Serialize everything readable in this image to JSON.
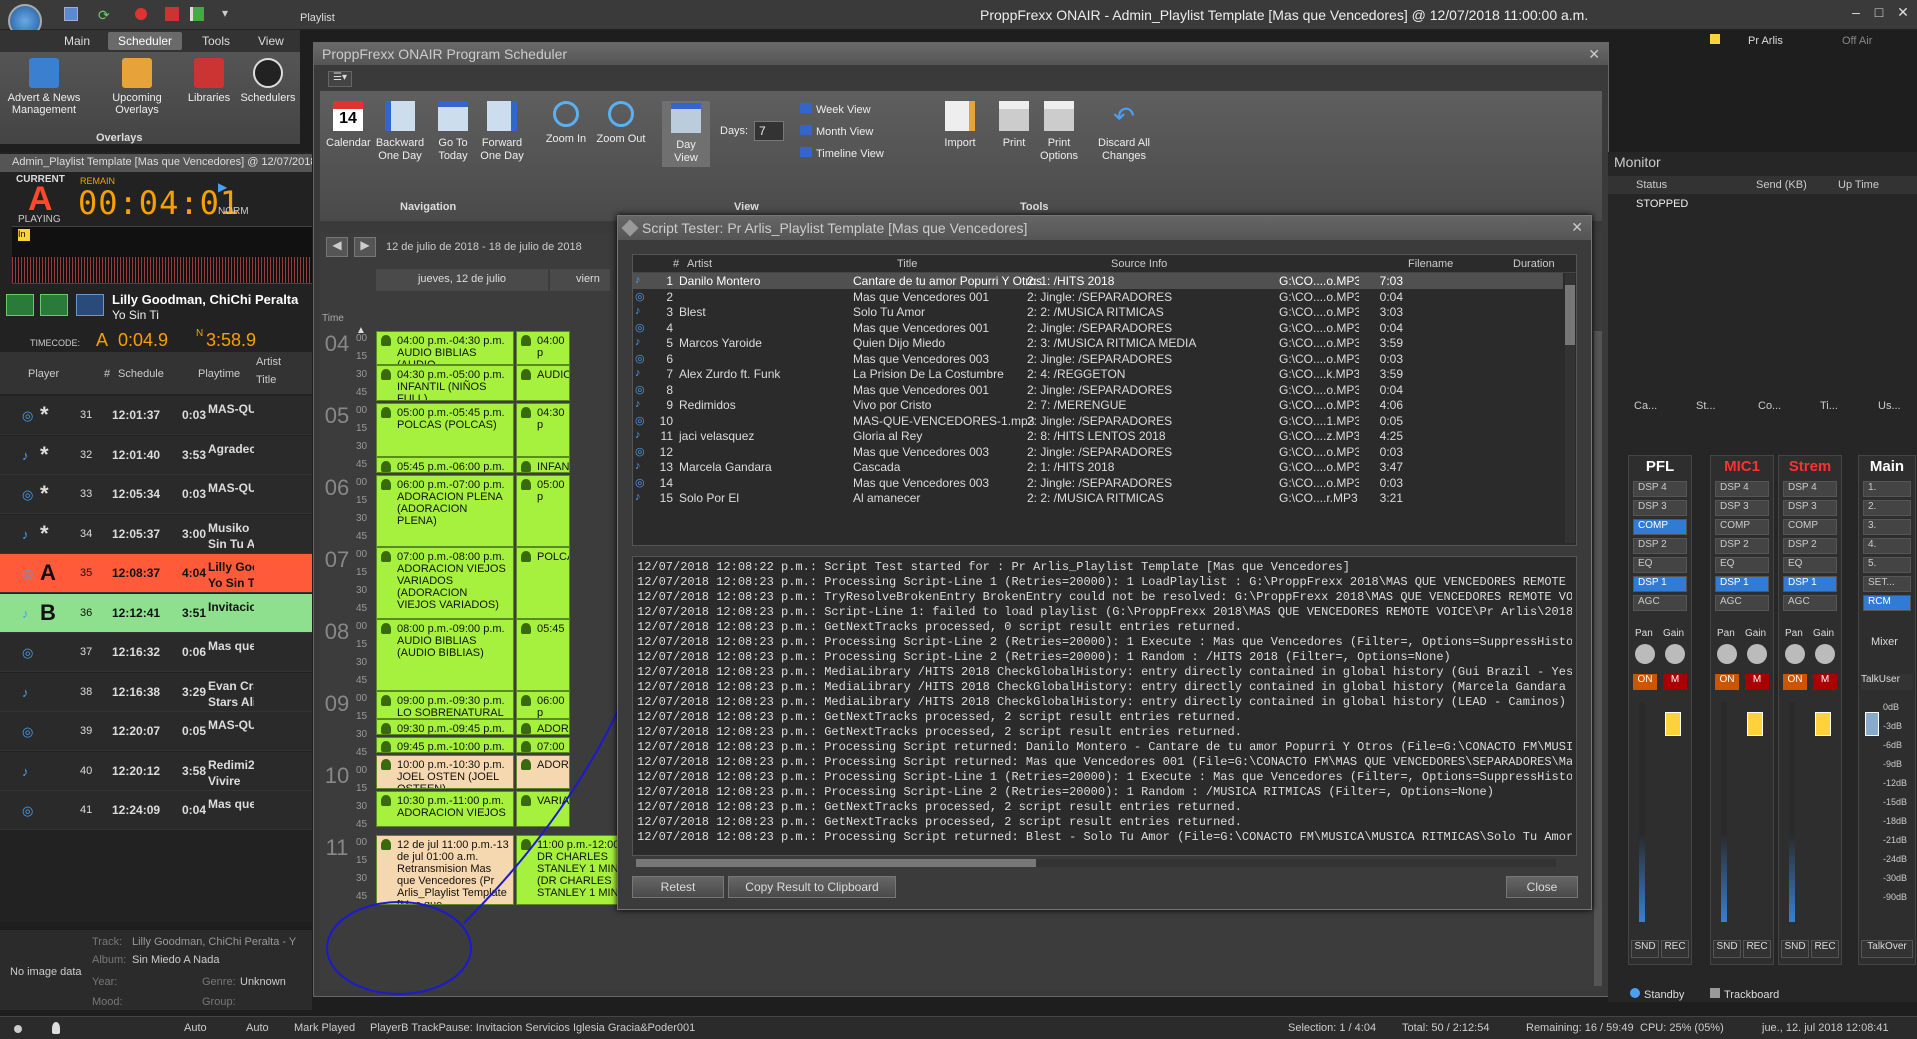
{
  "app": {
    "title": "ProppFrexx ONAIR - Admin_Playlist Template [Mas que Vencedores] @ 12/07/2018 11:00:00 a.m.",
    "playlist_tab": "Playlist",
    "user": "Pr Arlis",
    "off_air": "Off Air"
  },
  "ribbon": {
    "tabs": [
      "Main",
      "Scheduler",
      "Tools",
      "View"
    ],
    "buttons": [
      "Advert & News Management",
      "Upcoming Overlays",
      "Libraries",
      "Schedulers"
    ],
    "group": "Overlays"
  },
  "player": {
    "header": "Admin_Playlist Template [Mas que Vencedores] @ 12/07/2018",
    "current": "CURRENT",
    "deck": "A",
    "playing": "PLAYING",
    "remain_label": "REMAIN",
    "remain": "00:04:01",
    "mode": "NORM",
    "artist": "Lilly Goodman, ChiChi Peralta",
    "title": "Yo Sin Ti",
    "timecode_label": "TIMECODE:",
    "pos_a": "A",
    "pos_a_time": "0:04.9",
    "pos_n": "N",
    "pos_n_time": "3:58.9"
  },
  "playlist": {
    "columns": [
      "Player",
      "#",
      "Schedule",
      "Playtime",
      "Artist",
      "Title"
    ],
    "rows": [
      {
        "player": "*",
        "num": "31",
        "schedule": "12:01:37",
        "playtime": "0:03",
        "artist": "MAS-QUI",
        "title": ""
      },
      {
        "player": "*",
        "num": "32",
        "schedule": "12:01:40",
        "playtime": "3:53",
        "artist": "Agradeci",
        "title": ""
      },
      {
        "player": "*",
        "num": "33",
        "schedule": "12:05:34",
        "playtime": "0:03",
        "artist": "MAS-QUI",
        "title": ""
      },
      {
        "player": "*",
        "num": "34",
        "schedule": "12:05:37",
        "playtime": "3:00",
        "artist": "Musiko",
        "title": "Sin Tu Ar"
      },
      {
        "player": "A",
        "num": "35",
        "schedule": "12:08:37",
        "playtime": "4:04",
        "artist": "Lilly Goo",
        "title": "Yo Sin Ti"
      },
      {
        "player": "B",
        "num": "36",
        "schedule": "12:12:41",
        "playtime": "3:51",
        "artist": "Invitacio",
        "title": ""
      },
      {
        "player": "",
        "num": "37",
        "schedule": "12:16:32",
        "playtime": "0:06",
        "artist": "Mas que",
        "title": ""
      },
      {
        "player": "",
        "num": "38",
        "schedule": "12:16:38",
        "playtime": "3:29",
        "artist": "Evan Cra",
        "title": "Stars Alig"
      },
      {
        "player": "",
        "num": "39",
        "schedule": "12:20:07",
        "playtime": "0:05",
        "artist": "MAS-QUI",
        "title": ""
      },
      {
        "player": "",
        "num": "40",
        "schedule": "12:20:12",
        "playtime": "3:58",
        "artist": "Redimi2",
        "title": "Vivire"
      },
      {
        "player": "",
        "num": "41",
        "schedule": "12:24:09",
        "playtime": "0:04",
        "artist": "Mas que",
        "title": ""
      }
    ]
  },
  "info": {
    "no_image": "No image data",
    "track_label": "Track:",
    "track": "Lilly Goodman, ChiChi Peralta - Y",
    "album_label": "Album:",
    "album": "Sin Miedo A Nada",
    "year_label": "Year:",
    "genre_label": "Genre:",
    "genre": "Unknown",
    "mood_label": "Mood:",
    "group_label": "Group:"
  },
  "scheduler": {
    "title": "ProppFrexx ONAIR Program Scheduler",
    "buttons": {
      "calendar": "Calendar",
      "backward": "Backward One Day",
      "goto_today": "Go To Today",
      "forward": "Forward One Day",
      "zoom_in": "Zoom In",
      "zoom_out": "Zoom Out",
      "day_view": "Day View",
      "days_label": "Days:",
      "days_value": "7",
      "week_view": "Week View",
      "month_view": "Month View",
      "timeline_view": "Timeline View",
      "import": "Import",
      "print": "Print",
      "print_options": "Print Options",
      "discard": "Discard All Changes"
    },
    "groups": {
      "navigation": "Navigation",
      "view": "View",
      "tools": "Tools"
    },
    "calendar_day": "14",
    "date_range": "12 de julio de 2018 - 18 de julio de 2018",
    "day1": "jueves, 12 de julio",
    "day2": "viern",
    "time_label": "Time",
    "hours": [
      "04",
      "05",
      "06",
      "07",
      "08",
      "09",
      "10",
      "11"
    ],
    "events": [
      "04:00 p.m.-04:30 p.m. AUDIO BIBLIAS (AUDIO",
      "04:30 p.m.-05:00 p.m. INFANTIL (NIÑOS FULL)",
      "05:00 p.m.-05:45 p.m. POLCAS (POLCAS)",
      "05:45 p.m.-06:00 p.m.",
      "06:00 p.m.-07:00 p.m. ADORACION PLENA (ADORACION PLENA)",
      "07:00 p.m.-08:00 p.m. ADORACION VIEJOS VARIADOS (ADORACION VIEJOS VARIADOS)",
      "08:00 p.m.-09:00 p.m. AUDIO BIBLIAS (AUDIO BIBLIAS)",
      "09:00 p.m.-09:30 p.m. LO SOBRENATURAL RADIO (LO",
      "09:30 p.m.-09:45 p.m.",
      "09:45 p.m.-10:00 p.m.",
      "10:00 p.m.-10:30 p.m. JOEL OSTEN (JOEL OSTEEN)",
      "10:30 p.m.-11:00 p.m. ADORACION VIEJOS",
      "12 de jul 11:00 p.m.-13 de jul 01:00 a.m. Retransmision Mas que Vencedores (Pr Arlis_Playlist Template [Mas que Vencedores])"
    ],
    "col2_events": [
      "04:00 p",
      "AUDIO",
      "04:30 p",
      "INFANT",
      "05:00 p",
      "POLCA",
      "05:45",
      "06:00 p",
      "ADORA",
      "07:00 p",
      "ADORA",
      "VARIAL",
      "VIEJOS",
      "08:00 p",
      "AUDIO",
      "BIBLIA",
      "09:00 p",
      "SOBRE",
      "09:3",
      "09:4",
      "10:00",
      "OSTEN",
      "10:30",
      "ADOR"
    ],
    "stanley": "11:00 p.m.-12:00 a.m. DR CHARLES STANLEY 1 MINUTO (DR CHARLES STANLEY 1 MINUTO)"
  },
  "script_tester": {
    "title": "Script Tester: Pr Arlis_Playlist Template [Mas que Vencedores]",
    "columns": [
      "#",
      "Artist",
      "Title",
      "Source Info",
      "Filename",
      "Duration"
    ],
    "rows": [
      {
        "n": "1",
        "artist": "Danilo Montero",
        "title": "Cantare de tu amor Popurri Y Otros",
        "source": "2: 1: /HITS 2018",
        "file": "G:\\CO....o.MP3",
        "dur": "7:03"
      },
      {
        "n": "2",
        "artist": "",
        "title": "Mas que Vencedores 001",
        "source": "2: Jingle: /SEPARADORES",
        "file": "G:\\CO....o.MP3",
        "dur": "0:04"
      },
      {
        "n": "3",
        "artist": "Blest",
        "title": "Solo Tu Amor",
        "source": "2: 2: /MUSICA RITMICAS",
        "file": "G:\\CO....o.MP3",
        "dur": "3:03"
      },
      {
        "n": "4",
        "artist": "",
        "title": "Mas que Vencedores 001",
        "source": "2: Jingle: /SEPARADORES",
        "file": "G:\\CO....o.MP3",
        "dur": "0:04"
      },
      {
        "n": "5",
        "artist": "Marcos Yaroide",
        "title": "Quien Dijo Miedo",
        "source": "2: 3: /MUSICA RITMICA MEDIA",
        "file": "G:\\CO....o.MP3",
        "dur": "3:59"
      },
      {
        "n": "6",
        "artist": "",
        "title": "Mas que Vencedores 003",
        "source": "2: Jingle: /SEPARADORES",
        "file": "G:\\CO....o.MP3",
        "dur": "0:03"
      },
      {
        "n": "7",
        "artist": "Alex Zurdo ft. Funk",
        "title": "La Prision De La Costumbre",
        "source": "2: 4: /REGGETON",
        "file": "G:\\CO....k.MP3",
        "dur": "3:59"
      },
      {
        "n": "8",
        "artist": "",
        "title": "Mas que Vencedores 001",
        "source": "2: Jingle: /SEPARADORES",
        "file": "G:\\CO....o.MP3",
        "dur": "0:04"
      },
      {
        "n": "9",
        "artist": "Redimidos",
        "title": "Vivo por Cristo",
        "source": "2: 7: /MERENGUE",
        "file": "G:\\CO....o.MP3",
        "dur": "4:06"
      },
      {
        "n": "10",
        "artist": "",
        "title": "MAS-QUE-VENCEDORES-1.mp3",
        "source": "2: Jingle: /SEPARADORES",
        "file": "G:\\CO....1.MP3",
        "dur": "0:05"
      },
      {
        "n": "11",
        "artist": "jaci velasquez",
        "title": "Gloria al Rey",
        "source": "2: 8: /HITS LENTOS 2018",
        "file": "G:\\CO....z.MP3",
        "dur": "4:25"
      },
      {
        "n": "12",
        "artist": "",
        "title": "Mas que Vencedores 003",
        "source": "2: Jingle: /SEPARADORES",
        "file": "G:\\CO....o.MP3",
        "dur": "0:03"
      },
      {
        "n": "13",
        "artist": "Marcela Gandara",
        "title": "Cascada",
        "source": "2: 1: /HITS 2018",
        "file": "G:\\CO....o.MP3",
        "dur": "3:47"
      },
      {
        "n": "14",
        "artist": "",
        "title": "Mas que Vencedores 003",
        "source": "2: Jingle: /SEPARADORES",
        "file": "G:\\CO....o.MP3",
        "dur": "0:03"
      },
      {
        "n": "15",
        "artist": "Solo Por El",
        "title": "Al amanecer",
        "source": "2: 2: /MUSICA RITMICAS",
        "file": "G:\\CO....r.MP3",
        "dur": "3:21"
      }
    ],
    "log": [
      "12/07/2018 12:08:22 p.m.: Script Test started for : Pr Arlis_Playlist Template [Mas que Vencedores]",
      "12/07/2018 12:08:23 p.m.: Processing Script-Line 1 (Retries=20000): 1 LoadPlaylist : G:\\ProppFrexx 2018\\MAS QUE VENCEDORES REMOTE VO",
      "12/07/2018 12:08:23 p.m.: TryResolveBrokenEntry BrokenEntry could not be resolved: G:\\ProppFrexx 2018\\MAS QUE VENCEDORES REMOTE VOI",
      "12/07/2018 12:08:23 p.m.: Script-Line 1: failed to load playlist (G:\\ProppFrexx 2018\\MAS QUE VENCEDORES REMOTE VOICE\\Pr Arlis\\201807",
      "12/07/2018 12:08:23 p.m.: GetNextTracks processed, 0 script result entries returned.",
      "12/07/2018 12:08:23 p.m.: Processing Script-Line 2 (Retries=20000): 1 Execute : Mas que Vencedores (Filter=, Options=SuppressHistory",
      "12/07/2018 12:08:23 p.m.: Processing Script-Line 2 (Retries=20000): 1 Random : /HITS 2018 (Filter=, Options=None)",
      "12/07/2018 12:08:23 p.m.: MediaLibrary /HITS 2018 CheckGlobalHistory: entry directly contained in global history (Gui Brazil - Yeshu",
      "12/07/2018 12:08:23 p.m.: MediaLibrary /HITS 2018 CheckGlobalHistory: entry directly contained in global history (Marcela Gandara -",
      "12/07/2018 12:08:23 p.m.: MediaLibrary /HITS 2018 CheckGlobalHistory: entry directly contained in global history (LEAD - Caminos)",
      "12/07/2018 12:08:23 p.m.: GetNextTracks processed, 2 script result entries returned.",
      "12/07/2018 12:08:23 p.m.: GetNextTracks processed, 2 script result entries returned.",
      "12/07/2018 12:08:23 p.m.: Processing Script returned: Danilo Montero - Cantare de tu amor Popurri Y Otros (File=G:\\CONACTO FM\\MUSICA",
      "12/07/2018 12:08:23 p.m.: Processing Script returned: Mas que Vencedores 001 (File=G:\\CONACTO FM\\MAS QUE VENCEDORES\\SEPARADORES\\Mas",
      "12/07/2018 12:08:23 p.m.: Processing Script-Line 1 (Retries=20000): 1 Execute : Mas que Vencedores (Filter=, Options=SuppressHistory",
      "12/07/2018 12:08:23 p.m.: Processing Script-Line 2 (Retries=20000): 1 Random : /MUSICA RITMICAS (Filter=, Options=None)",
      "12/07/2018 12:08:23 p.m.: GetNextTracks processed, 2 script result entries returned.",
      "12/07/2018 12:08:23 p.m.: GetNextTracks processed, 2 script result entries returned.",
      "12/07/2018 12:08:23 p.m.: Processing Script returned: Blest - Solo Tu Amor (File=G:\\CONACTO FM\\MUSICA\\MUSICA RITMICAS\\Solo Tu Amor -"
    ],
    "retest": "Retest",
    "copy": "Copy Result to Clipboard",
    "close": "Close"
  },
  "monitor": {
    "title": "Monitor",
    "columns": [
      "Status",
      "Send (KB)",
      "Up Time"
    ],
    "status": "STOPPED",
    "tabs": [
      "Ca...",
      "St...",
      "Co...",
      "Ti...",
      "Us..."
    ]
  },
  "mixer": {
    "channels": [
      {
        "name": "PFL",
        "color": "#ffffff",
        "dsp": [
          "DSP 4",
          "DSP 3",
          "COMP",
          "DSP 2",
          "EQ",
          "DSP 1",
          "AGC"
        ]
      },
      {
        "name": "MIC1",
        "color": "#ff3030",
        "dsp": [
          "DSP 4",
          "DSP 3",
          "COMP",
          "DSP 2",
          "EQ",
          "DSP 1",
          "AGC"
        ]
      },
      {
        "name": "Strem",
        "color": "#ff3030",
        "dsp": [
          "DSP 4",
          "DSP 3",
          "COMP",
          "DSP 2",
          "EQ",
          "DSP 1",
          "AGC"
        ]
      },
      {
        "name": "Main",
        "color": "#ffffff",
        "dsp": [
          "1.",
          "2.",
          "3.",
          "4.",
          "5.",
          "SET...",
          "RCM"
        ]
      }
    ],
    "pan": "Pan",
    "gain": "Gain",
    "on": "ON",
    "m": "M",
    "snd": "SND",
    "rec": "REC",
    "mixer_label": "Mixer",
    "talkuser": "TalkUser",
    "talkover": "TalkOver",
    "db_marks": [
      "0dB",
      "-3dB",
      "-6dB",
      "-9dB",
      "-12dB",
      "-15dB",
      "-18dB",
      "-21dB",
      "-24dB",
      "-30dB",
      "-90dB"
    ],
    "standby": "Standby",
    "trackboard": "Trackboard"
  },
  "statusbar": {
    "auto1": "Auto",
    "auto2": "Auto",
    "mark_played": "Mark Played",
    "trackpause": "PlayerB TrackPause: Invitacion Servicios Iglesia Gracia&Poder001",
    "selection": "Selection: 1 / 4:04",
    "total": "Total: 50 / 2:12:54",
    "remaining": "Remaining: 16 / 59:49",
    "cpu": "CPU: 25% (05%)",
    "datetime": "jue., 12. jul 2018 12:08:41"
  }
}
